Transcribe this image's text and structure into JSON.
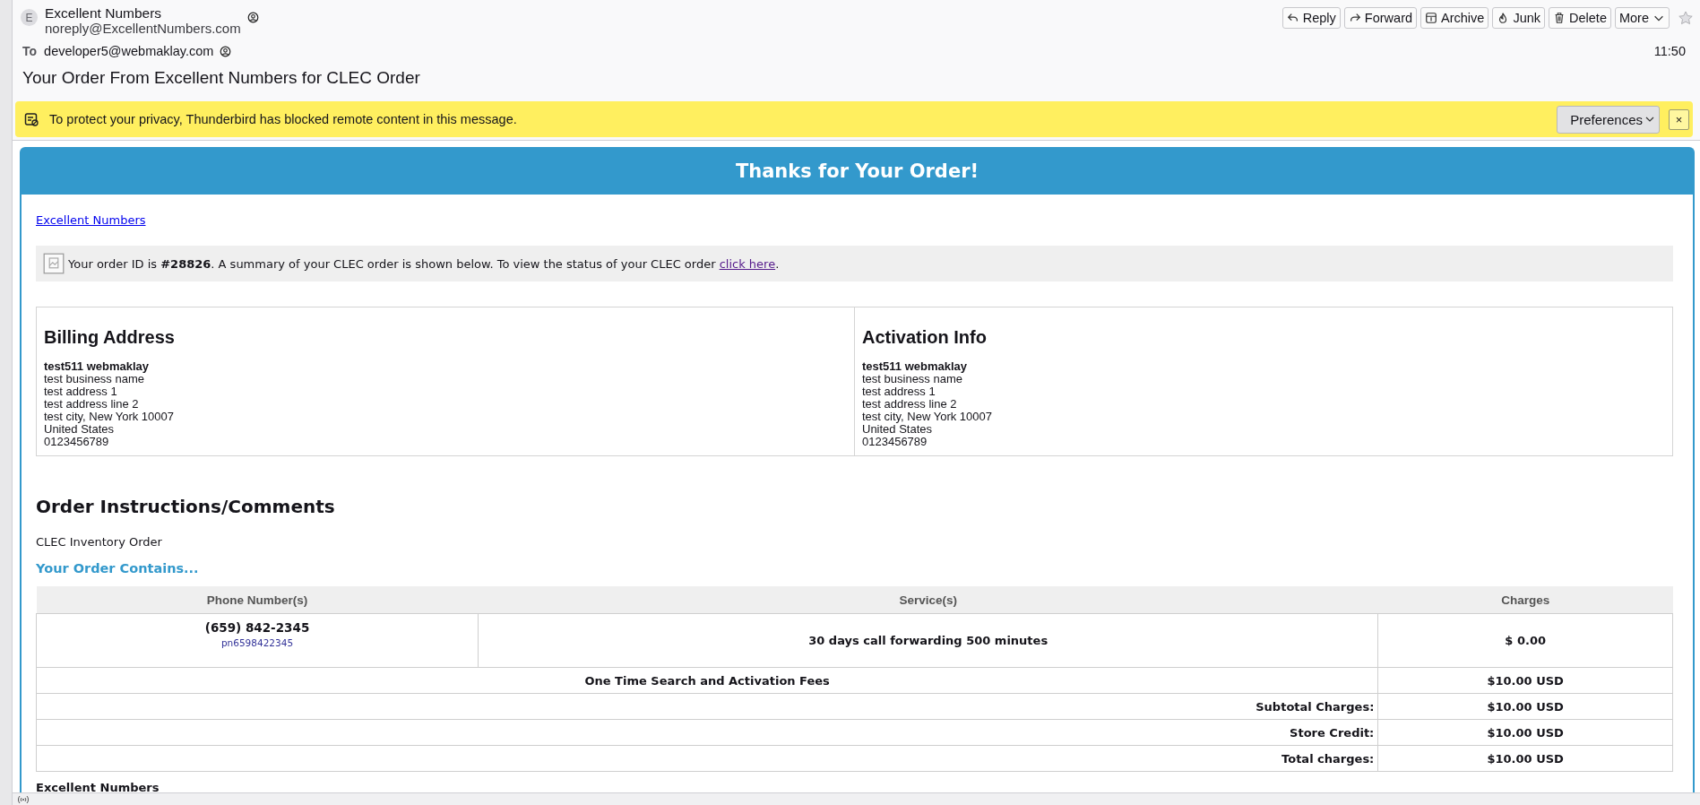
{
  "message_header": {
    "sender_initial": "E",
    "sender_name": "Excellent Numbers",
    "sender_email": "noreply@ExcellentNumbers.com",
    "to_label": "To",
    "recipient": "developer5@webmaklay.com",
    "time": "11:50",
    "subject": "Your Order From Excellent Numbers for CLEC Order",
    "starred": false
  },
  "toolbar": [
    {
      "label": "Reply",
      "kind": "reply"
    },
    {
      "label": "Forward",
      "kind": "forward"
    },
    {
      "label": "Archive",
      "kind": "archive"
    },
    {
      "label": "Junk",
      "kind": "junk"
    },
    {
      "label": "Delete",
      "kind": "delete"
    },
    {
      "label": "More",
      "kind": "menu"
    }
  ],
  "notification": {
    "text": "To protect your privacy, Thunderbird has blocked remote content in this message.",
    "button": "Preferences",
    "close": "×"
  },
  "email": {
    "banner_title": "Thanks for Your Order!",
    "brand_link": "Excellent Numbers",
    "order_notice": "Your order ID is **#28826**. A summary of your CLEC order is shown below. To view the status of your CLEC order ",
    "notice_link": "click here",
    "notice_end": ".",
    "addresses": [
      {
        "title": "Billing Address",
        "name": "test511 webmaklay",
        "lines": [
          "test business name",
          "test address 1",
          "test address line 2",
          "test city, New York 10007",
          "United States",
          "0123456789"
        ]
      },
      {
        "title": "Activation Info",
        "name": "test511 webmaklay",
        "lines": [
          "test business name",
          "test address 1",
          "test address line 2",
          "test city, New York 10007",
          "United States",
          "0123456789"
        ]
      }
    ],
    "instructions_title": "Order Instructions/Comments",
    "instructions_text": "CLEC Inventory Order",
    "contains_title": "Your Order Contains...",
    "order_table": {
      "columns": [
        "Phone Number(s)",
        "Service(s)",
        "Charges"
      ],
      "items": [
        {
          "phone": "(659) 842-2345",
          "phone_id": "pn6598422345",
          "service": "30 days call forwarding 500 minutes",
          "charge": "$ 0.00"
        }
      ],
      "fees": {
        "label": "One Time Search and Activation Fees",
        "value": "$10.00 USD"
      },
      "totals": [
        {
          "label": "Subtotal Charges:",
          "value": "$10.00 USD"
        },
        {
          "label": "Store Credit:",
          "value": "$10.00 USD"
        },
        {
          "label": "Total charges:",
          "value": "$10.00 USD"
        }
      ]
    },
    "signature": "Excellent Numbers"
  }
}
